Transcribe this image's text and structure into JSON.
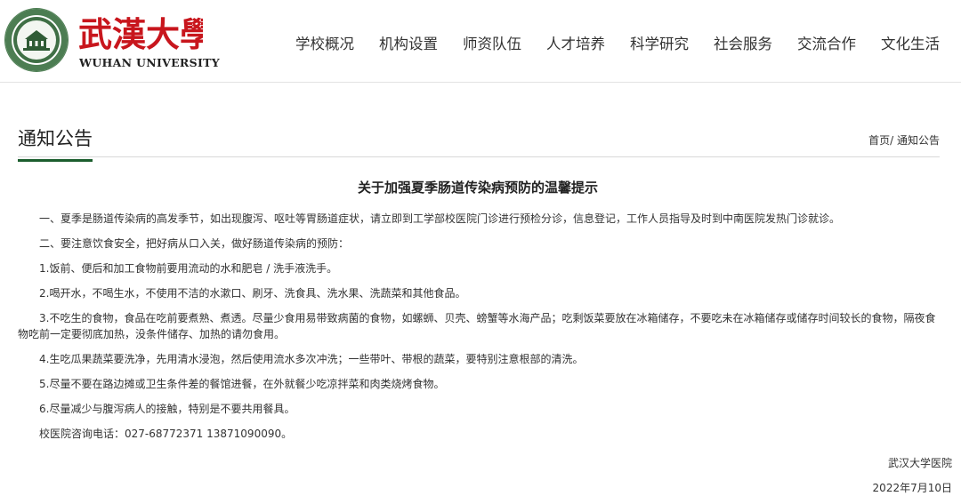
{
  "header": {
    "logo_cn": "武漢大學",
    "logo_en": "WUHAN UNIVERSITY",
    "nav": [
      "学校概况",
      "机构设置",
      "师资队伍",
      "人才培养",
      "科学研究",
      "社会服务",
      "交流合作",
      "文化生活"
    ]
  },
  "section": {
    "title": "通知公告",
    "breadcrumb": {
      "home": "首页",
      "separator": "/ ",
      "current": "通知公告"
    }
  },
  "article": {
    "title": "关于加强夏季肠道传染病预防的温馨提示",
    "paragraphs": [
      "一、夏季是肠道传染病的高发季节，如出现腹泻、呕吐等胃肠道症状，请立即到工学部校医院门诊进行预检分诊，信息登记，工作人员指导及时到中南医院发热门诊就诊。",
      "二、要注意饮食安全，把好病从口入关，做好肠道传染病的预防：",
      "1.饭前、便后和加工食物前要用流动的水和肥皂 / 洗手液洗手。",
      "2.喝开水，不喝生水，不使用不洁的水漱口、刷牙、洗食具、洗水果、洗蔬菜和其他食品。",
      "3.不吃生的食物，食品在吃前要煮熟、煮透。尽量少食用易带致病菌的食物，如螺蛳、贝壳、螃蟹等水海产品；吃剩饭菜要放在冰箱储存，不要吃未在冰箱储存或储存时间较长的食物，隔夜食物吃前一定要彻底加热，没条件储存、加热的请勿食用。",
      "4.生吃瓜果蔬菜要洗净，先用清水浸泡，然后使用流水多次冲洗；一些带叶、带根的蔬菜，要特别注意根部的清洗。",
      "5.尽量不要在路边摊或卫生条件差的餐馆进餐，在外就餐少吃凉拌菜和肉类烧烤食物。",
      "6.尽量减少与腹泻病人的接触，特别是不要共用餐具。",
      "校医院咨询电话：027-68772371 13871090090。"
    ],
    "signature": "武汉大学医院",
    "date": "2022年7月10日"
  },
  "colors": {
    "brand_red": "#c8161d",
    "brand_green": "#1b5d2d"
  }
}
